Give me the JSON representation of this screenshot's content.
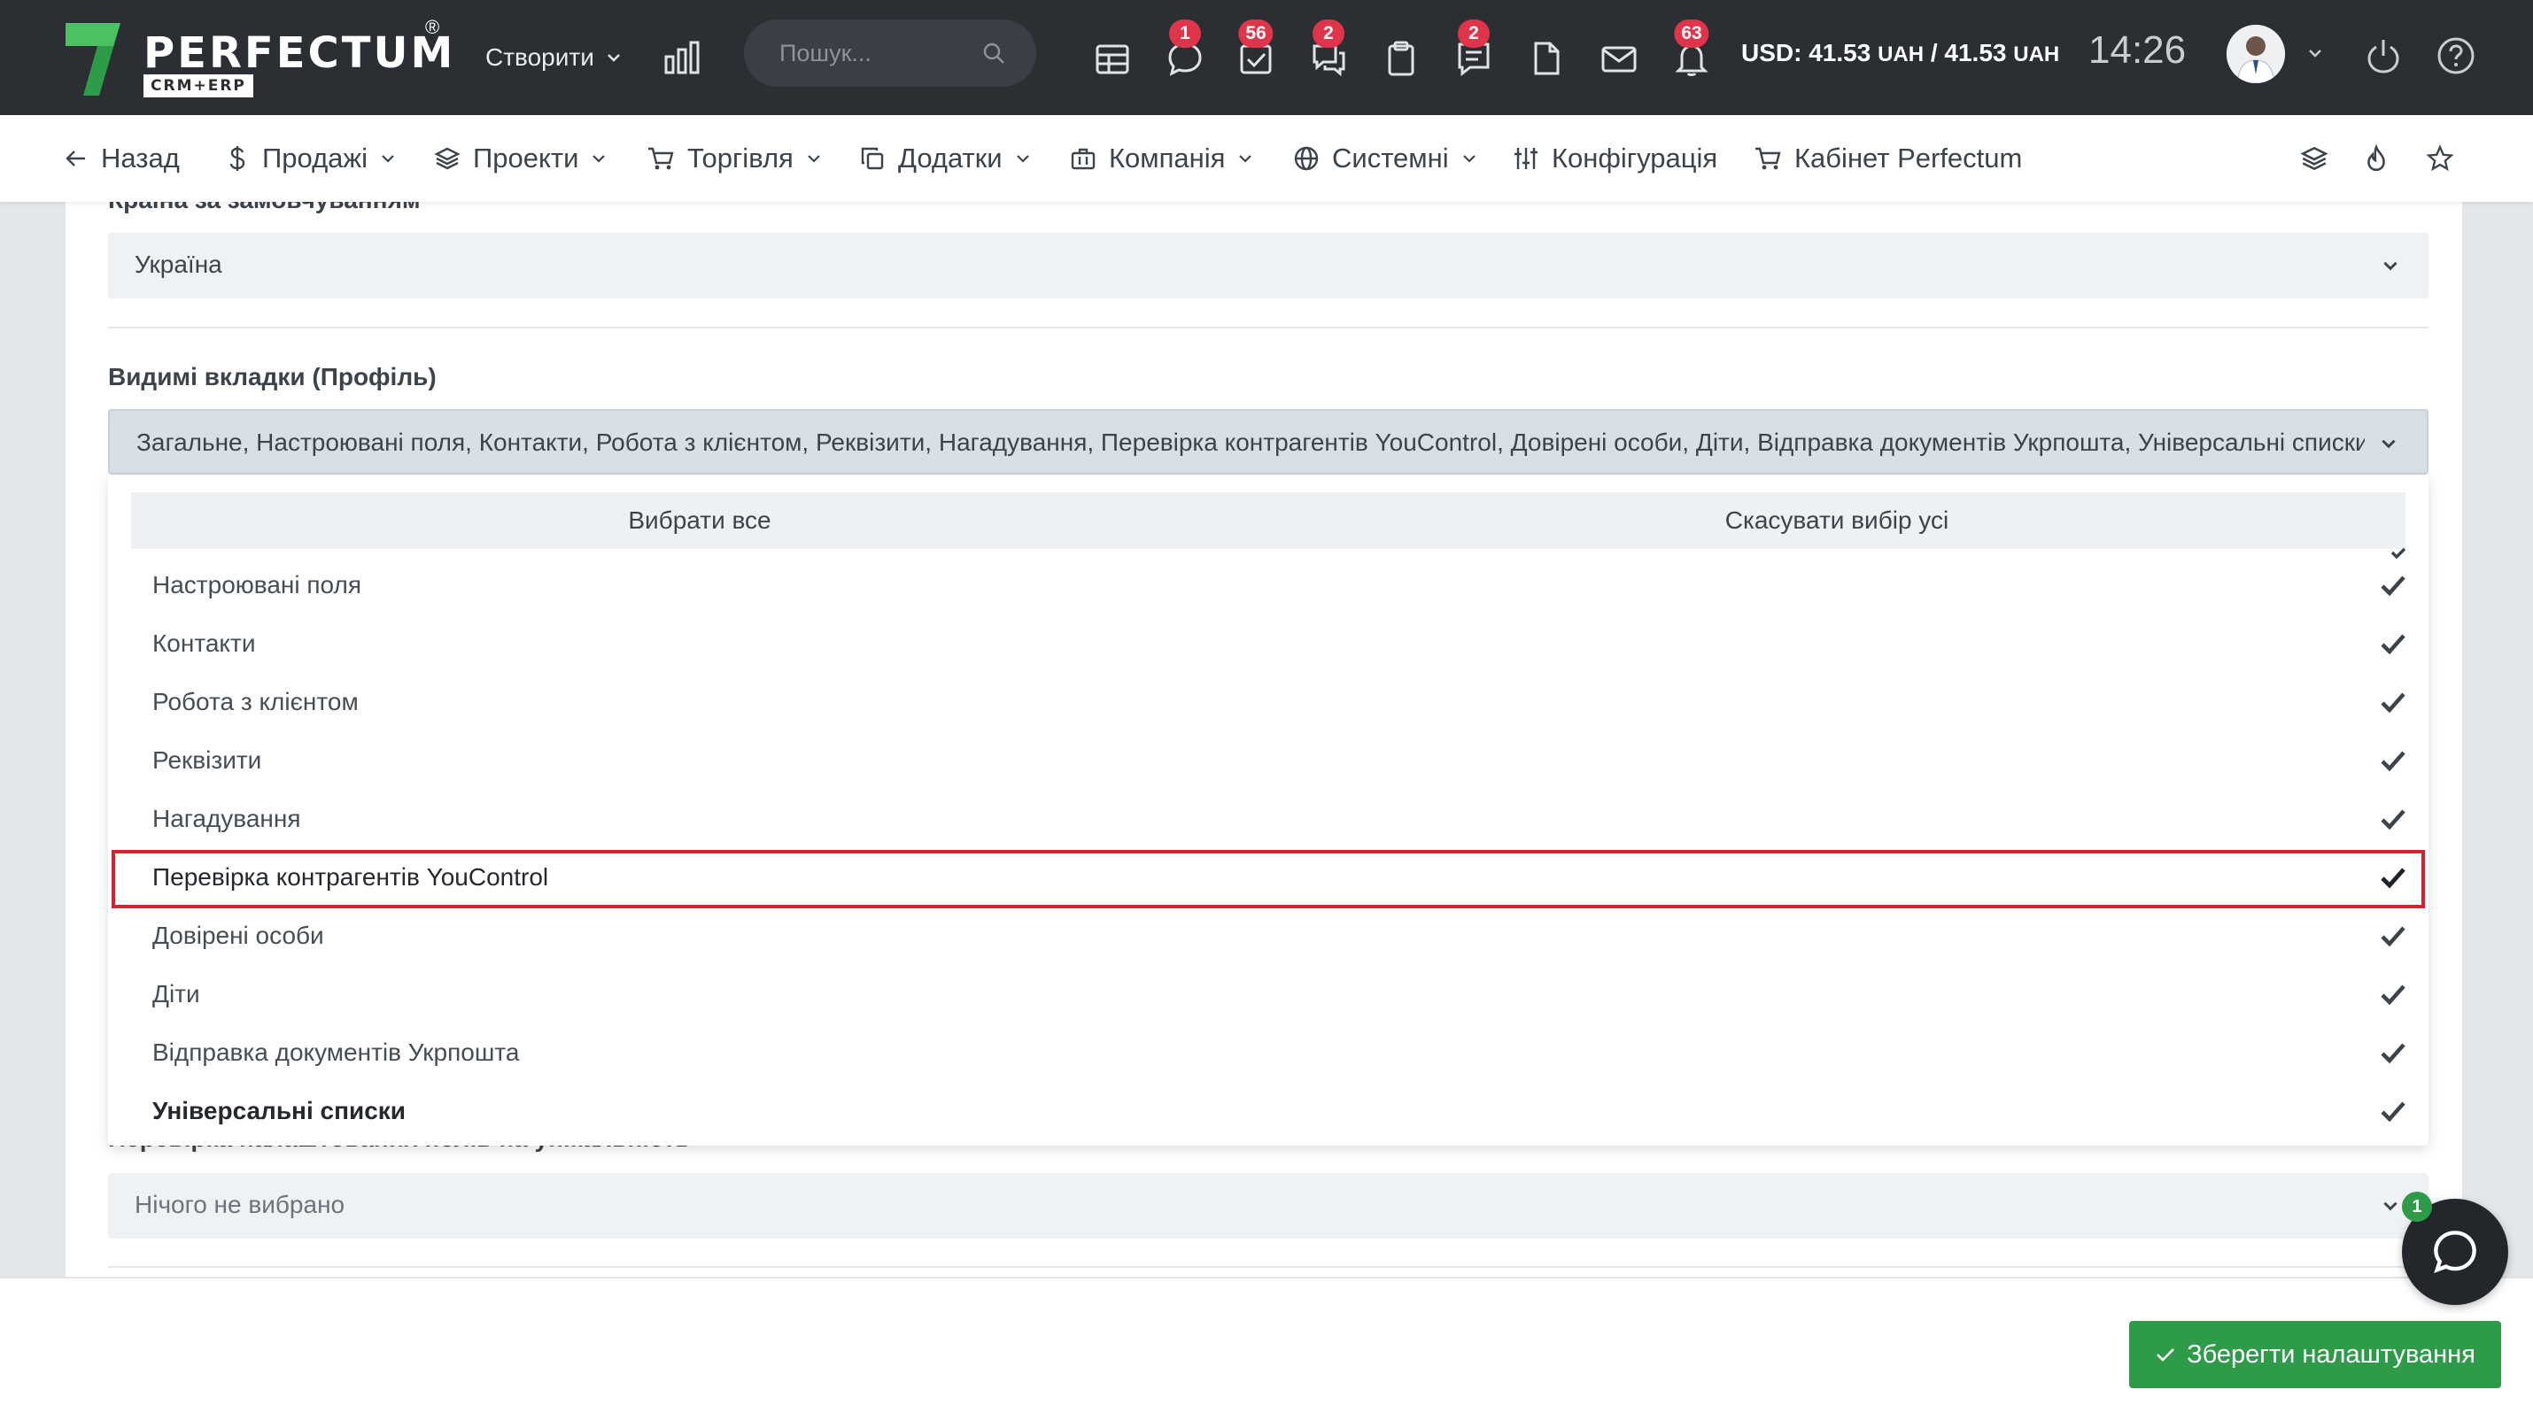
{
  "topbar": {
    "logo_text": "PERFECTUM",
    "logo_sub": "CRM+ERP",
    "logo_reg": "®",
    "create_label": "Створити",
    "search_placeholder": "Пошук...",
    "badges": {
      "chat": "1",
      "tasks": "56",
      "comments": "2",
      "messages": "2",
      "notifications": "63"
    },
    "currency_prefix": "USD: 41.53 ",
    "currency_unit_1": "UAH",
    "currency_mid": " / 41.53 ",
    "currency_unit_2": "UAH",
    "clock": "14:26",
    "accent_color": "#e0344b"
  },
  "nav": {
    "back": "Назад",
    "sales": "Продажі",
    "projects": "Проекти",
    "trade": "Торгівля",
    "addons": "Додатки",
    "company": "Компанія",
    "system": "Системні",
    "config": "Конфігурація",
    "cabinet": "Кабінет Perfectum"
  },
  "form": {
    "country_label": "Країна за замовчуванням",
    "country_value": "Україна",
    "tabs_label": "Видимі вкладки (Профіль)",
    "tabs_value": "Загальне, Настроювані поля, Контакти, Робота з клієнтом, Реквізити, Нагадування, Перевірка контрагентів YouControl, Довірені особи, Діти, Відправка документів Укрпошта, Універсальні списки",
    "unique_label": "Перевірка налаштованих полів на унікальність",
    "unique_value": "Нічого не вибрано"
  },
  "dropdown": {
    "select_all": "Вибрати все",
    "deselect_all": "Скасувати вибір усі",
    "items": [
      {
        "label": "Настроювані поля",
        "checked": true
      },
      {
        "label": "Контакти",
        "checked": true
      },
      {
        "label": "Робота з клієнтом",
        "checked": true
      },
      {
        "label": "Реквізити",
        "checked": true
      },
      {
        "label": "Нагадування",
        "checked": true
      },
      {
        "label": "Перевірка контрагентів YouControl",
        "checked": true,
        "highlighted": true
      },
      {
        "label": "Довірені особи",
        "checked": true
      },
      {
        "label": "Діти",
        "checked": true
      },
      {
        "label": "Відправка документів Укрпошта",
        "checked": true
      },
      {
        "label": "Універсальні списки",
        "checked": true
      }
    ]
  },
  "footer": {
    "save_label": "Зберегти налаштування",
    "save_color": "#2e9b48"
  },
  "chat": {
    "badge": "1"
  }
}
